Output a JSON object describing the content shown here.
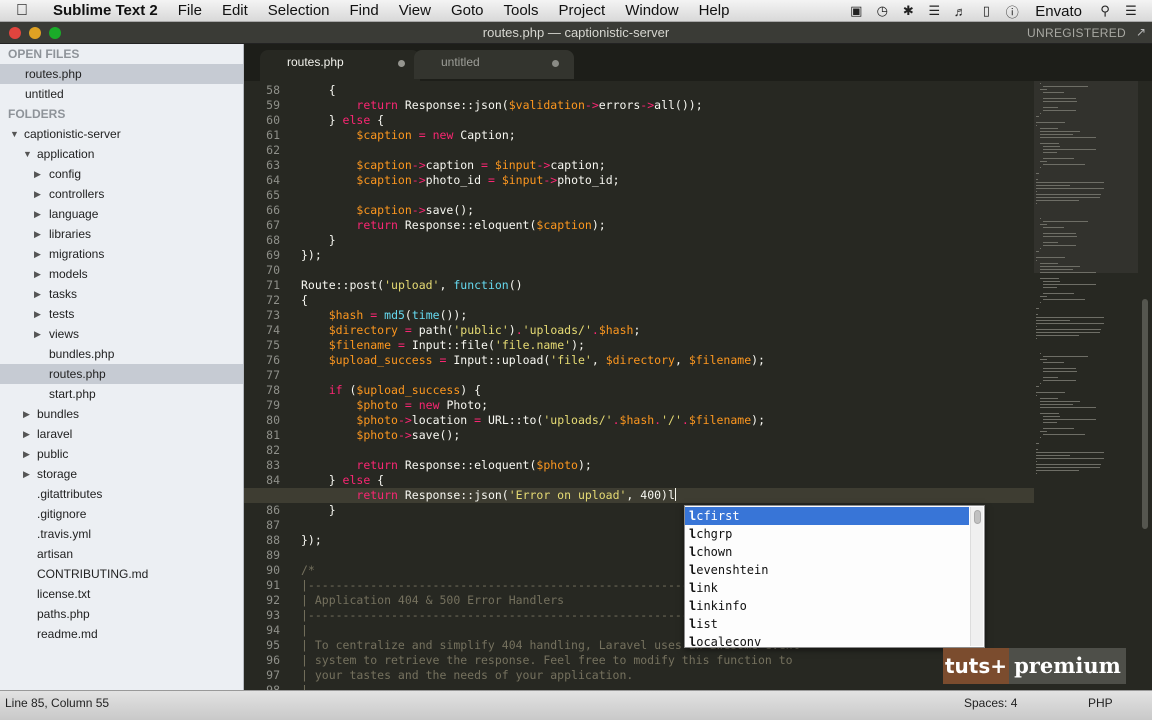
{
  "menubar": {
    "app_name": "Sublime Text 2",
    "items": [
      "File",
      "Edit",
      "Selection",
      "Find",
      "View",
      "Goto",
      "Tools",
      "Project",
      "Window",
      "Help"
    ],
    "user": "Envato"
  },
  "window": {
    "title": "routes.php — captionistic-server",
    "license_status": "UNREGISTERED"
  },
  "sidebar": {
    "open_files_header": "OPEN FILES",
    "open_files": [
      "routes.php",
      "untitled"
    ],
    "folders_header": "FOLDERS",
    "tree": [
      {
        "label": "captionistic-server",
        "depth": 0,
        "type": "folder",
        "expanded": true
      },
      {
        "label": "application",
        "depth": 1,
        "type": "folder",
        "expanded": true
      },
      {
        "label": "config",
        "depth": 2,
        "type": "folder",
        "expanded": false
      },
      {
        "label": "controllers",
        "depth": 2,
        "type": "folder",
        "expanded": false
      },
      {
        "label": "language",
        "depth": 2,
        "type": "folder",
        "expanded": false
      },
      {
        "label": "libraries",
        "depth": 2,
        "type": "folder",
        "expanded": false
      },
      {
        "label": "migrations",
        "depth": 2,
        "type": "folder",
        "expanded": false
      },
      {
        "label": "models",
        "depth": 2,
        "type": "folder",
        "expanded": false
      },
      {
        "label": "tasks",
        "depth": 2,
        "type": "folder",
        "expanded": false
      },
      {
        "label": "tests",
        "depth": 2,
        "type": "folder",
        "expanded": false
      },
      {
        "label": "views",
        "depth": 2,
        "type": "folder",
        "expanded": false
      },
      {
        "label": "bundles.php",
        "depth": 2,
        "type": "file"
      },
      {
        "label": "routes.php",
        "depth": 2,
        "type": "file",
        "selected": true
      },
      {
        "label": "start.php",
        "depth": 2,
        "type": "file"
      },
      {
        "label": "bundles",
        "depth": 1,
        "type": "folder",
        "expanded": false
      },
      {
        "label": "laravel",
        "depth": 1,
        "type": "folder",
        "expanded": false
      },
      {
        "label": "public",
        "depth": 1,
        "type": "folder",
        "expanded": false
      },
      {
        "label": "storage",
        "depth": 1,
        "type": "folder",
        "expanded": false
      },
      {
        "label": ".gitattributes",
        "depth": 1,
        "type": "file"
      },
      {
        "label": ".gitignore",
        "depth": 1,
        "type": "file"
      },
      {
        "label": ".travis.yml",
        "depth": 1,
        "type": "file"
      },
      {
        "label": "artisan",
        "depth": 1,
        "type": "file"
      },
      {
        "label": "CONTRIBUTING.md",
        "depth": 1,
        "type": "file"
      },
      {
        "label": "license.txt",
        "depth": 1,
        "type": "file"
      },
      {
        "label": "paths.php",
        "depth": 1,
        "type": "file"
      },
      {
        "label": "readme.md",
        "depth": 1,
        "type": "file"
      }
    ]
  },
  "tabs": [
    {
      "label": "routes.php",
      "active": true
    },
    {
      "label": "untitled",
      "active": false
    }
  ],
  "editor": {
    "current_line": 85,
    "lines": [
      {
        "n": "58",
        "tokens": [
          [
            "",
            "    {"
          ]
        ]
      },
      {
        "n": "59",
        "tokens": [
          [
            "",
            "        "
          ],
          [
            "kw",
            "return"
          ],
          [
            "",
            " Response::json("
          ],
          [
            "var",
            "$validation"
          ],
          [
            "kw",
            "->"
          ],
          [
            "",
            "errors"
          ],
          [
            "kw",
            "->"
          ],
          [
            "",
            "all());"
          ]
        ]
      },
      {
        "n": "60",
        "tokens": [
          [
            "",
            "    } "
          ],
          [
            "kw",
            "else"
          ],
          [
            "",
            " {"
          ]
        ]
      },
      {
        "n": "61",
        "tokens": [
          [
            "",
            "        "
          ],
          [
            "var",
            "$caption"
          ],
          [
            "",
            " "
          ],
          [
            "kw",
            "="
          ],
          [
            "",
            " "
          ],
          [
            "kw",
            "new"
          ],
          [
            "",
            " Caption;"
          ]
        ]
      },
      {
        "n": "62",
        "tokens": [
          [
            "",
            ""
          ]
        ]
      },
      {
        "n": "63",
        "tokens": [
          [
            "",
            "        "
          ],
          [
            "var",
            "$caption"
          ],
          [
            "kw",
            "->"
          ],
          [
            "",
            "caption "
          ],
          [
            "kw",
            "="
          ],
          [
            "",
            " "
          ],
          [
            "var",
            "$input"
          ],
          [
            "kw",
            "->"
          ],
          [
            "",
            "caption;"
          ]
        ]
      },
      {
        "n": "64",
        "tokens": [
          [
            "",
            "        "
          ],
          [
            "var",
            "$caption"
          ],
          [
            "kw",
            "->"
          ],
          [
            "",
            "photo_id "
          ],
          [
            "kw",
            "="
          ],
          [
            "",
            " "
          ],
          [
            "var",
            "$input"
          ],
          [
            "kw",
            "->"
          ],
          [
            "",
            "photo_id;"
          ]
        ]
      },
      {
        "n": "65",
        "tokens": [
          [
            "",
            ""
          ]
        ]
      },
      {
        "n": "66",
        "tokens": [
          [
            "",
            "        "
          ],
          [
            "var",
            "$caption"
          ],
          [
            "kw",
            "->"
          ],
          [
            "",
            "save();"
          ]
        ]
      },
      {
        "n": "67",
        "tokens": [
          [
            "",
            "        "
          ],
          [
            "kw",
            "return"
          ],
          [
            "",
            " Response::eloquent("
          ],
          [
            "var",
            "$caption"
          ],
          [
            "",
            ");"
          ]
        ]
      },
      {
        "n": "68",
        "tokens": [
          [
            "",
            "    }"
          ]
        ]
      },
      {
        "n": "69",
        "tokens": [
          [
            "",
            "});"
          ]
        ]
      },
      {
        "n": "70",
        "tokens": [
          [
            "",
            ""
          ]
        ]
      },
      {
        "n": "71",
        "tokens": [
          [
            "",
            "Route::post("
          ],
          [
            "str",
            "'upload'"
          ],
          [
            "",
            ", "
          ],
          [
            "fn",
            "function"
          ],
          [
            "",
            "()"
          ]
        ]
      },
      {
        "n": "72",
        "tokens": [
          [
            "",
            "{"
          ]
        ]
      },
      {
        "n": "73",
        "tokens": [
          [
            "",
            "    "
          ],
          [
            "var",
            "$hash"
          ],
          [
            "",
            " "
          ],
          [
            "kw",
            "="
          ],
          [
            "",
            " "
          ],
          [
            "fn",
            "md5"
          ],
          [
            "",
            "("
          ],
          [
            "fn",
            "time"
          ],
          [
            "",
            "());"
          ]
        ]
      },
      {
        "n": "74",
        "tokens": [
          [
            "",
            "    "
          ],
          [
            "var",
            "$directory"
          ],
          [
            "",
            " "
          ],
          [
            "kw",
            "="
          ],
          [
            "",
            " path("
          ],
          [
            "str",
            "'public'"
          ],
          [
            "",
            ")"
          ],
          [
            "kw",
            "."
          ],
          [
            "str",
            "'uploads/'"
          ],
          [
            "kw",
            "."
          ],
          [
            "var",
            "$hash"
          ],
          [
            "",
            ";"
          ]
        ]
      },
      {
        "n": "75",
        "tokens": [
          [
            "",
            "    "
          ],
          [
            "var",
            "$filename"
          ],
          [
            "",
            " "
          ],
          [
            "kw",
            "="
          ],
          [
            "",
            " Input::file("
          ],
          [
            "str",
            "'file.name'"
          ],
          [
            "",
            ");"
          ]
        ]
      },
      {
        "n": "76",
        "tokens": [
          [
            "",
            "    "
          ],
          [
            "var",
            "$upload_success"
          ],
          [
            "",
            " "
          ],
          [
            "kw",
            "="
          ],
          [
            "",
            " Input::upload("
          ],
          [
            "str",
            "'file'"
          ],
          [
            "",
            ", "
          ],
          [
            "var",
            "$directory"
          ],
          [
            "",
            ", "
          ],
          [
            "var",
            "$filename"
          ],
          [
            "",
            ");"
          ]
        ]
      },
      {
        "n": "77",
        "tokens": [
          [
            "",
            ""
          ]
        ]
      },
      {
        "n": "78",
        "tokens": [
          [
            "",
            "    "
          ],
          [
            "kw",
            "if"
          ],
          [
            "",
            " ("
          ],
          [
            "var",
            "$upload_success"
          ],
          [
            "",
            ") {"
          ]
        ]
      },
      {
        "n": "79",
        "tokens": [
          [
            "",
            "        "
          ],
          [
            "var",
            "$photo"
          ],
          [
            "",
            " "
          ],
          [
            "kw",
            "="
          ],
          [
            "",
            " "
          ],
          [
            "kw",
            "new"
          ],
          [
            "",
            " Photo;"
          ]
        ]
      },
      {
        "n": "80",
        "tokens": [
          [
            "",
            "        "
          ],
          [
            "var",
            "$photo"
          ],
          [
            "kw",
            "->"
          ],
          [
            "",
            "location "
          ],
          [
            "kw",
            "="
          ],
          [
            "",
            " URL::to("
          ],
          [
            "str",
            "'uploads/'"
          ],
          [
            "kw",
            "."
          ],
          [
            "var",
            "$hash"
          ],
          [
            "kw",
            "."
          ],
          [
            "str",
            "'/'"
          ],
          [
            "kw",
            "."
          ],
          [
            "var",
            "$filename"
          ],
          [
            "",
            ");"
          ]
        ]
      },
      {
        "n": "81",
        "tokens": [
          [
            "",
            "        "
          ],
          [
            "var",
            "$photo"
          ],
          [
            "kw",
            "->"
          ],
          [
            "",
            "save();"
          ]
        ]
      },
      {
        "n": "82",
        "tokens": [
          [
            "",
            ""
          ]
        ]
      },
      {
        "n": "83",
        "tokens": [
          [
            "",
            "        "
          ],
          [
            "kw",
            "return"
          ],
          [
            "",
            " Response::eloquent("
          ],
          [
            "var",
            "$photo"
          ],
          [
            "",
            ");"
          ]
        ]
      },
      {
        "n": "84",
        "tokens": [
          [
            "",
            "    } "
          ],
          [
            "kw",
            "else"
          ],
          [
            "",
            " {"
          ]
        ]
      },
      {
        "n": "85",
        "tokens": [
          [
            "",
            "        "
          ],
          [
            "kw",
            "return"
          ],
          [
            "",
            " Response::json("
          ],
          [
            "str",
            "'Error on upload'"
          ],
          [
            "",
            ", 400)l"
          ]
        ]
      },
      {
        "n": "86",
        "tokens": [
          [
            "",
            "    }"
          ]
        ]
      },
      {
        "n": "87",
        "tokens": [
          [
            "",
            ""
          ]
        ]
      },
      {
        "n": "88",
        "tokens": [
          [
            "",
            "});"
          ]
        ]
      },
      {
        "n": "89",
        "tokens": [
          [
            "",
            ""
          ]
        ]
      },
      {
        "n": "90",
        "tokens": [
          [
            "cmt",
            "/*"
          ]
        ]
      },
      {
        "n": "91",
        "tokens": [
          [
            "cmt",
            "|--------------------------------------------------------------------------"
          ]
        ]
      },
      {
        "n": "92",
        "tokens": [
          [
            "cmt",
            "| Application 404 & 500 Error Handlers"
          ]
        ]
      },
      {
        "n": "93",
        "tokens": [
          [
            "cmt",
            "|--------------------------------------------------------------------------"
          ]
        ]
      },
      {
        "n": "94",
        "tokens": [
          [
            "cmt",
            "|"
          ]
        ]
      },
      {
        "n": "95",
        "tokens": [
          [
            "cmt",
            "| To centralize and simplify 404 handling, Laravel uses an awesome event"
          ]
        ]
      },
      {
        "n": "96",
        "tokens": [
          [
            "cmt",
            "| system to retrieve the response. Feel free to modify this function to"
          ]
        ]
      },
      {
        "n": "97",
        "tokens": [
          [
            "cmt",
            "| your tastes and the needs of your application."
          ]
        ]
      },
      {
        "n": "98",
        "tokens": [
          [
            "cmt",
            "|"
          ]
        ]
      }
    ]
  },
  "autocomplete": {
    "typed_prefix": "l",
    "items": [
      "lcfirst",
      "lchgrp",
      "lchown",
      "levenshtein",
      "link",
      "linkinfo",
      "list",
      "localeconv"
    ],
    "selected_index": 0
  },
  "badge": {
    "left": "tuts+",
    "right": "premium"
  },
  "statusbar": {
    "position": "Line 85, Column 55",
    "indentation": "Spaces: 4",
    "syntax": "PHP"
  },
  "colors": {
    "editor_bg": "#272822",
    "keyword": "#f92672",
    "string": "#e6db74",
    "variable": "#fd971f",
    "function": "#66d9ef",
    "comment": "#75715e",
    "selection": "#3875d7"
  }
}
